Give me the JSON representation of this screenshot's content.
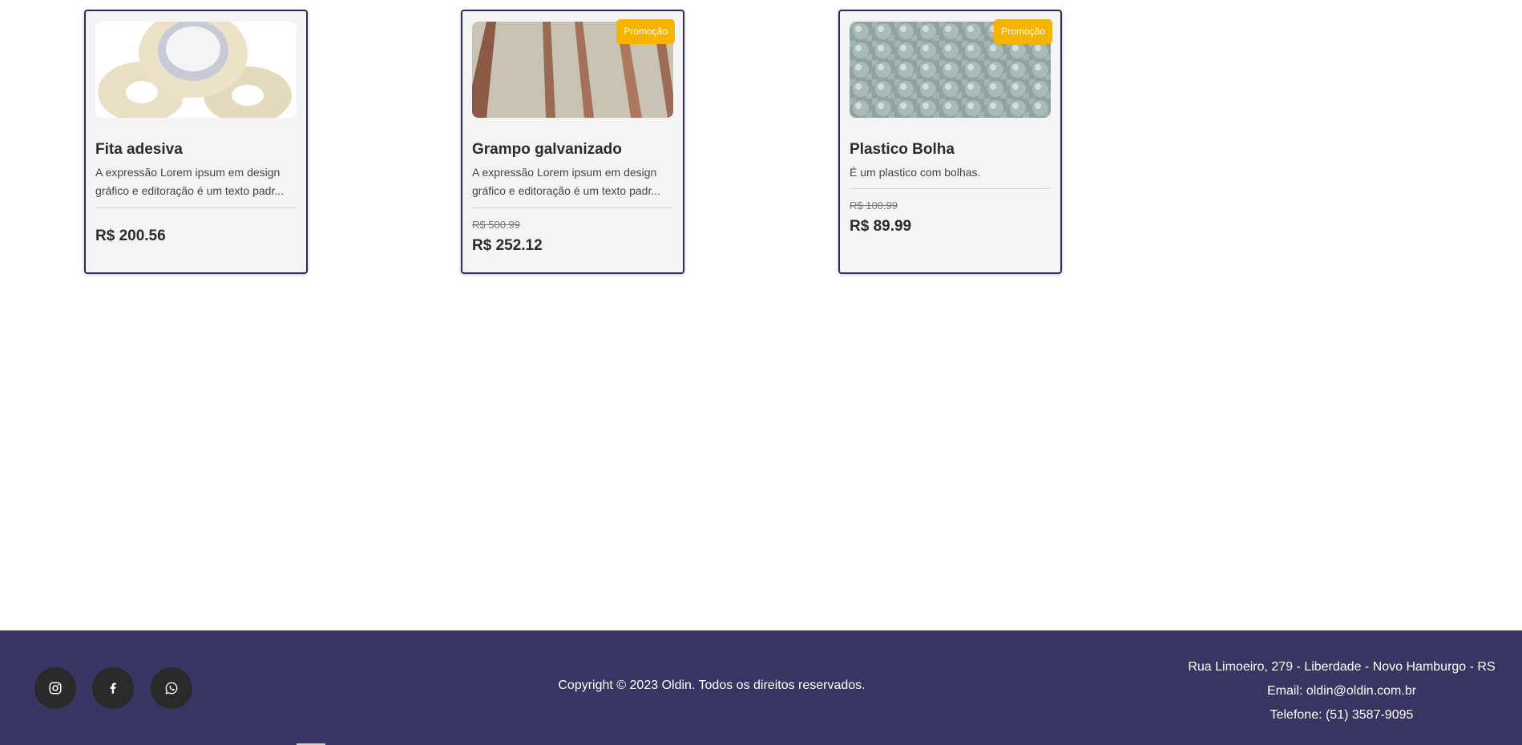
{
  "products": [
    {
      "title": "Fita adesiva",
      "description": "A expressão Lorem ipsum em design gráfico e editoração é um texto padr...",
      "price": "R$ 200.56",
      "image": "packing-tape-rolls"
    },
    {
      "badge": "Promoção",
      "title": "Grampo galvanizado",
      "description": "A expressão Lorem ipsum em design gráfico e editoração é um texto padr...",
      "old_price": "R$ 500.99",
      "price": "R$ 252.12",
      "image": "staple-strips"
    },
    {
      "badge": "Promoção",
      "title": "Plastico Bolha",
      "description": "É um plastico com bolhas.",
      "old_price": "R$ 100.99",
      "price": "R$ 89.99",
      "image": "bubble-wrap"
    }
  ],
  "footer": {
    "social": [
      "instagram-icon",
      "facebook-icon",
      "whatsapp-icon"
    ],
    "copyright": "Copyright © 2023 Oldin. Todos os direitos reservados.",
    "address": "Rua Limoeiro, 279 - Liberdade - Novo Hamburgo - RS",
    "email": "Email: oldin@oldin.com.br",
    "phone": "Telefone: (51) 3587-9095"
  },
  "colors": {
    "card_border": "#2e2c5e",
    "badge": "#f5b400",
    "footer_bg": "#383562",
    "social_bg": "#2a2a2a"
  }
}
